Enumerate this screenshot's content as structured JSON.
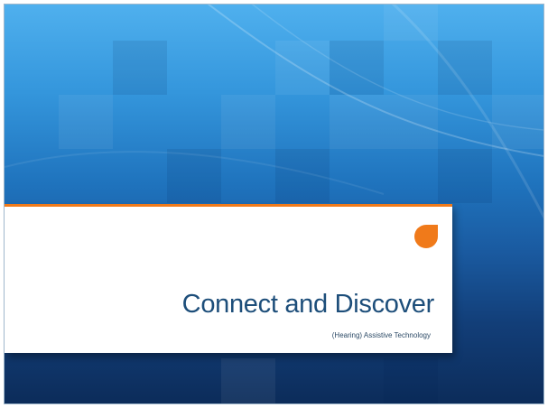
{
  "slide": {
    "title": "Connect and Discover",
    "subtitle": "(Hearing) Assistive Technology",
    "colors": {
      "accent": "#f07a1a",
      "title_text": "#1d4e7a",
      "background_top": "#4fb0ee",
      "background_bottom": "#0c2c5a"
    }
  }
}
